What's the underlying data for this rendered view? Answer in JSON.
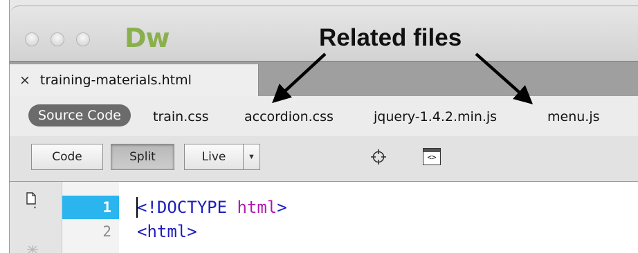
{
  "window": {
    "app_logo": "Dw"
  },
  "annotation": {
    "label": "Related files"
  },
  "document_tab": {
    "close_glyph": "×",
    "filename": "training-materials.html"
  },
  "related_files": {
    "source_code": "Source Code",
    "files": [
      "train.css",
      "accordion.css",
      "jquery-1.4.2.min.js",
      "menu.js"
    ]
  },
  "toolbar": {
    "code_label": "Code",
    "split_label": "Split",
    "live_label": "Live",
    "dropdown_icon": "triangle-down-icon",
    "inspect_icon": "crosshair-icon",
    "multiscreen_icon": "code-view-icon",
    "multiscreen_glyph": "<>"
  },
  "editor": {
    "line_numbers": [
      "1",
      "2"
    ],
    "current_line": 1,
    "lines": [
      {
        "open": "<!DOCTYPE ",
        "keyword": "html",
        "close": ">"
      },
      {
        "open": "<html>",
        "keyword": "",
        "close": ""
      }
    ],
    "colors": {
      "tag": "#1d1dbe",
      "keyword": "#b018b0",
      "line_highlight": "#2ab5ee",
      "logo": "#8ab04e"
    }
  }
}
